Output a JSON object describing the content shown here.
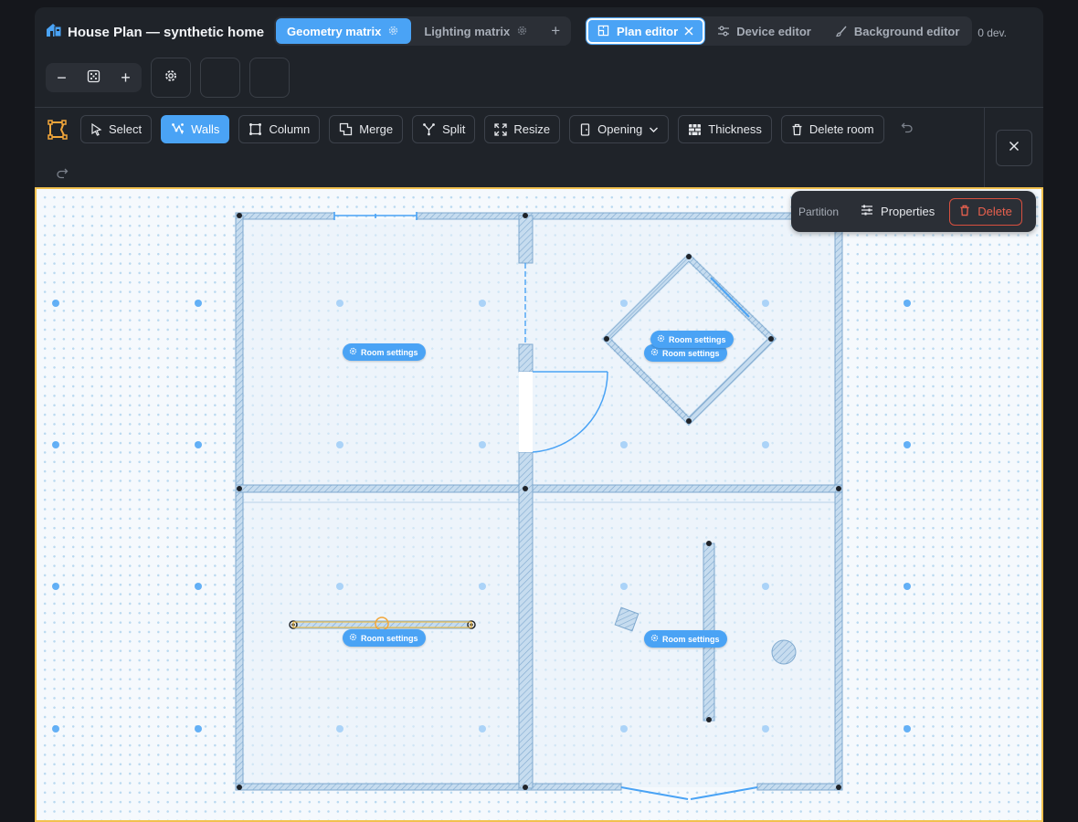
{
  "app": {
    "title": "House Plan — synthetic home",
    "device_count": "0 dev."
  },
  "tabs": [
    {
      "label": "Geometry matrix"
    },
    {
      "label": "Lighting matrix"
    }
  ],
  "editor_tabs": [
    {
      "label": "Plan editor"
    },
    {
      "label": "Device editor"
    },
    {
      "label": "Background editor"
    }
  ],
  "zoom": {
    "out": "−",
    "in": "+"
  },
  "toolbar": {
    "select": "Select",
    "walls": "Walls",
    "column": "Column",
    "merge": "Merge",
    "split": "Split",
    "resize": "Resize",
    "opening": "Opening",
    "thickness": "Thickness",
    "delete_room": "Delete room"
  },
  "popover": {
    "label": "Partition",
    "properties": "Properties",
    "delete": "Delete"
  },
  "room_settings_label": "Room settings",
  "colors": {
    "accent": "#4aa3f5",
    "danger": "#d8503f",
    "selection": "#f2c14e",
    "wall": "#a8cbe8"
  }
}
